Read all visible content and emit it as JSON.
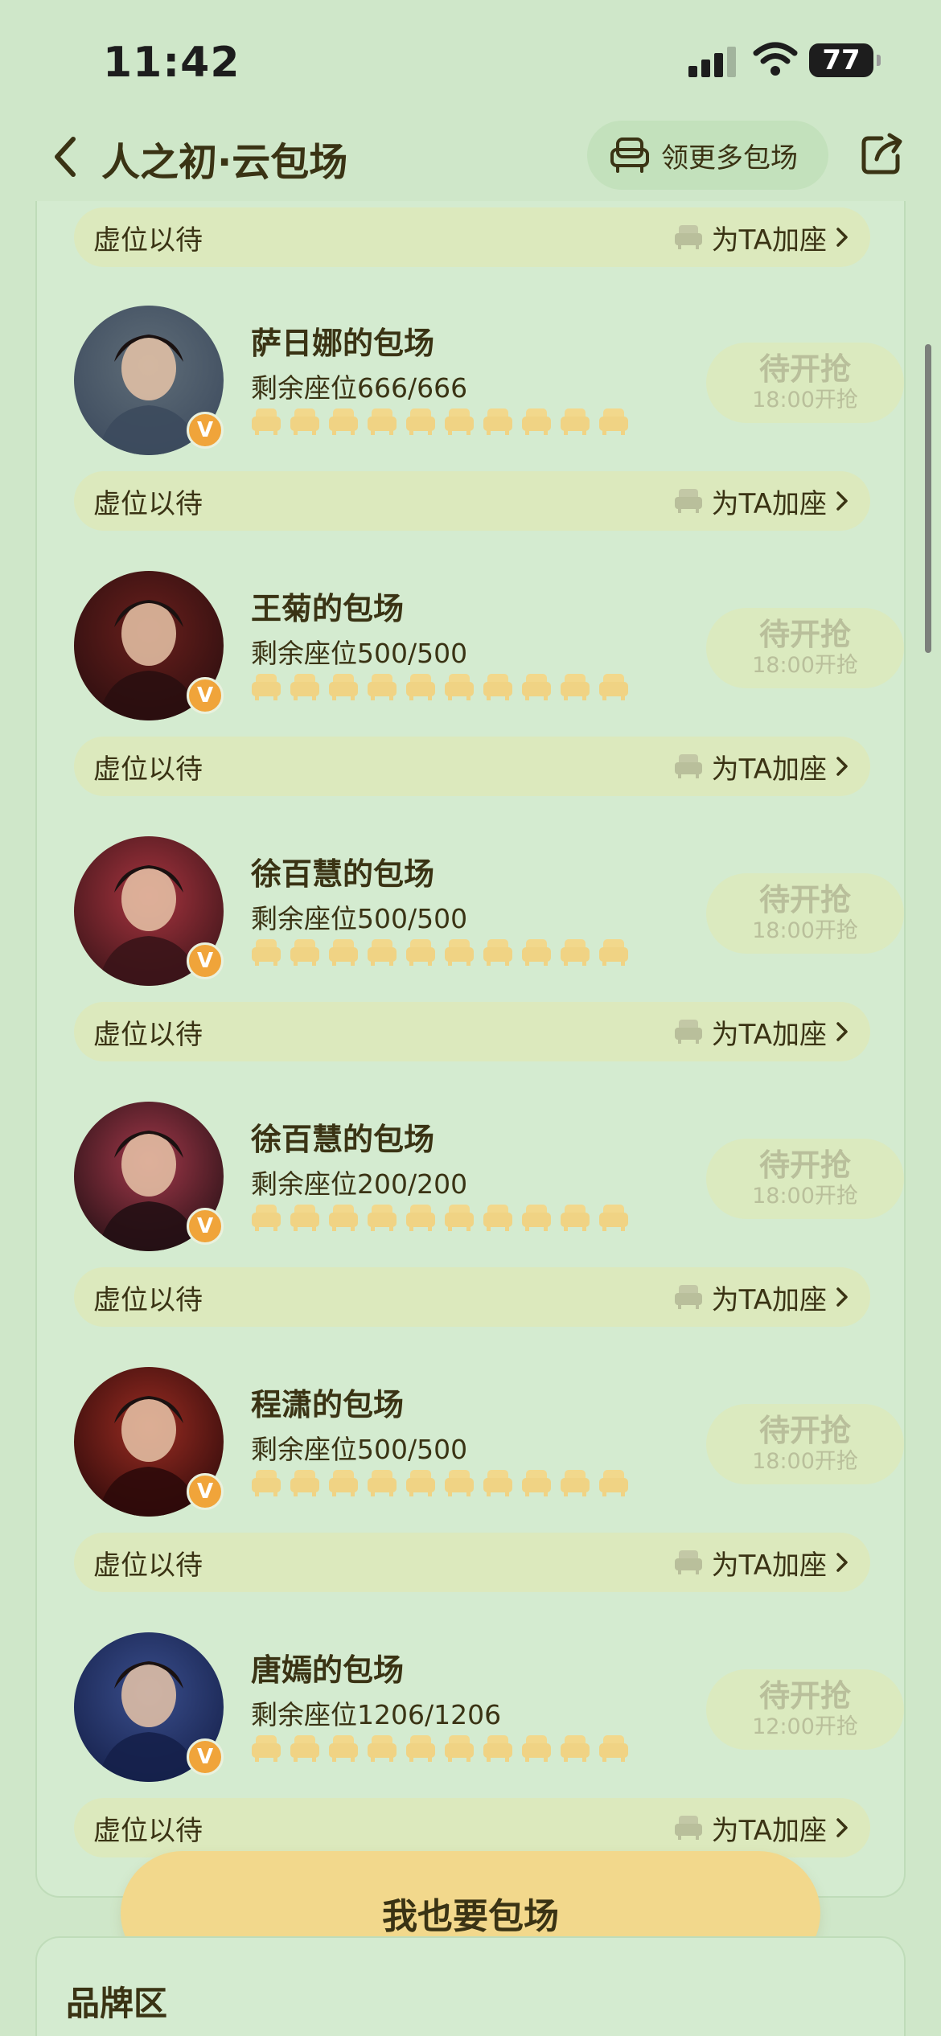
{
  "status": {
    "time": "11:42",
    "battery": "77"
  },
  "nav": {
    "title": "人之初·云包场",
    "more_label": "领更多包场"
  },
  "rows": {
    "empty_label": "虚位以待",
    "add_label": "为TA加座"
  },
  "cards": [
    {
      "name": "萨日娜的包场",
      "seats": "剩余座位666/666",
      "wait": "待开抢",
      "time": "18:00开抢",
      "avatar_colors": [
        "#5f6d78",
        "#3c4a5d"
      ]
    },
    {
      "name": "王菊的包场",
      "seats": "剩余座位500/500",
      "wait": "待开抢",
      "time": "18:00开抢",
      "avatar_colors": [
        "#6a1f1c",
        "#2a0e0f"
      ]
    },
    {
      "name": "徐百慧的包场",
      "seats": "剩余座位500/500",
      "wait": "待开抢",
      "time": "18:00开抢",
      "avatar_colors": [
        "#a8343f",
        "#3a1418"
      ]
    },
    {
      "name": "徐百慧的包场",
      "seats": "剩余座位200/200",
      "wait": "待开抢",
      "time": "18:00开抢",
      "avatar_colors": [
        "#a3384a",
        "#241014"
      ]
    },
    {
      "name": "程潇的包场",
      "seats": "剩余座位500/500",
      "wait": "待开抢",
      "time": "18:00开抢",
      "avatar_colors": [
        "#9b2c22",
        "#2d0a0a"
      ]
    },
    {
      "name": "唐嫣的包场",
      "seats": "剩余座位1206/1206",
      "wait": "待开抢",
      "time": "12:00开抢",
      "avatar_colors": [
        "#3a4e8c",
        "#15204a"
      ]
    }
  ],
  "cta": {
    "label": "我也要包场"
  },
  "brand": {
    "title": "品牌区"
  },
  "colors": {
    "background": "#cfe7c9",
    "panel": "#d4ebd0",
    "row": "#dce9bd",
    "cta": "#f2d88c",
    "seat": "#f2d88c",
    "badge": "#f0a43a"
  }
}
